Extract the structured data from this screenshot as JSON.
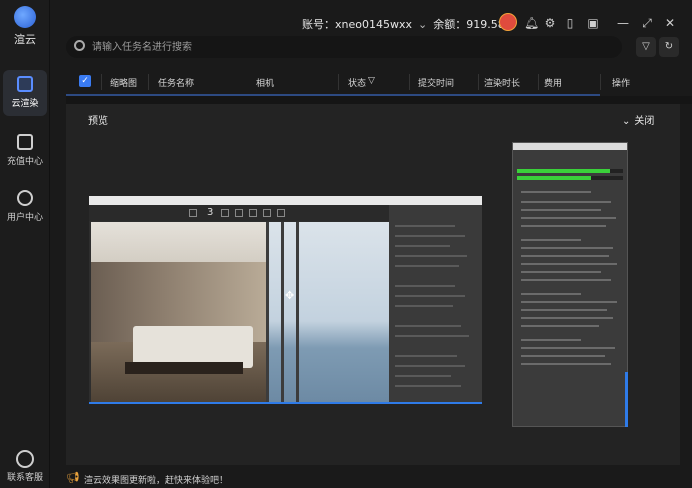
{
  "app": {
    "logo_text": "渲云"
  },
  "sidebar": {
    "items": [
      {
        "label": "云渲染",
        "icon": "render-icon",
        "active": true
      },
      {
        "label": "充值中心",
        "icon": "wallet-icon",
        "active": false
      },
      {
        "label": "用户中心",
        "icon": "user-icon",
        "active": false
      }
    ],
    "service_label": "联系客服"
  },
  "header": {
    "account_label": "账号：",
    "account_value": "xneo0145wxx",
    "balance_label": "余额：",
    "balance_value": "919.58",
    "icons": [
      "bell-icon",
      "settings-icon",
      "book-icon",
      "gift-icon",
      "minimize-icon",
      "fullscreen-icon",
      "close-icon"
    ]
  },
  "search": {
    "placeholder": "请输入任务名进行搜索"
  },
  "table": {
    "columns": [
      "缩略图",
      "任务名称",
      "相机",
      "状态",
      "提交时间",
      "渲染时长",
      "费用",
      "操作"
    ]
  },
  "preview": {
    "title": "预览",
    "close_label": "关闭",
    "render_window_frame": "3"
  },
  "footer": {
    "notice": "渲云效果图更新啦，赶快来体验吧！"
  },
  "colors": {
    "accent": "#3a7bf2",
    "background": "#1a1a1a",
    "panel": "#232323"
  }
}
